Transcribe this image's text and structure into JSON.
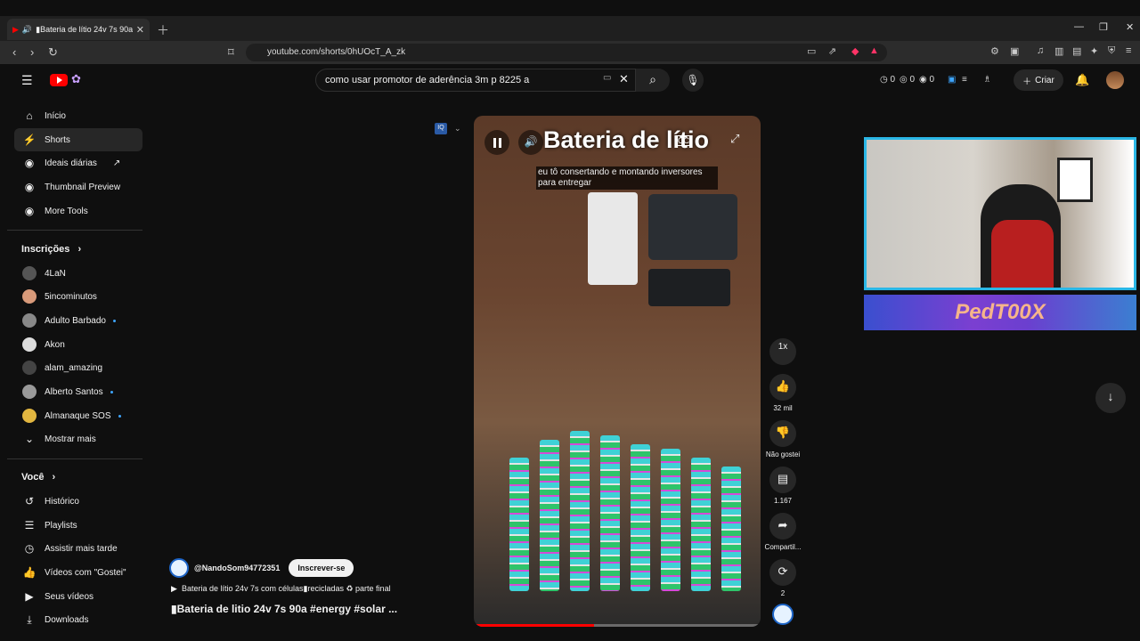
{
  "browser": {
    "tab_title": "▮Bateria de lítio 24v 7s 90a #",
    "url": "youtube.com/shorts/0hUOcT_A_zk"
  },
  "header": {
    "search_value": "como usar promotor de aderência 3m p 8225 a",
    "counts": [
      "0",
      "0",
      "0"
    ],
    "create_label": "Criar"
  },
  "sidebar": {
    "main": [
      {
        "label": "Início",
        "icon": "home-icon"
      },
      {
        "label": "Shorts",
        "icon": "shorts-icon"
      },
      {
        "label": "Ideais diárias",
        "icon": "tool-icon"
      },
      {
        "label": "Thumbnail Preview",
        "icon": "tool-icon"
      },
      {
        "label": "More Tools",
        "icon": "tool-icon"
      }
    ],
    "subscriptions_title": "Inscrições",
    "subscriptions": [
      {
        "label": "4LaN"
      },
      {
        "label": "5incominutos"
      },
      {
        "label": "Adulto Barbado"
      },
      {
        "label": "Akon"
      },
      {
        "label": "alam_amazing"
      },
      {
        "label": "Alberto Santos"
      },
      {
        "label": "Almanaque SOS"
      }
    ],
    "show_more": "Mostrar mais",
    "you_title": "Você",
    "you_items": [
      {
        "label": "Histórico",
        "icon": "history-icon"
      },
      {
        "label": "Playlists",
        "icon": "playlist-icon"
      },
      {
        "label": "Assistir mais tarde",
        "icon": "clock-icon"
      },
      {
        "label": "Vídeos com \"Gostei\"",
        "icon": "like-icon"
      },
      {
        "label": "Seus vídeos",
        "icon": "video-icon"
      },
      {
        "label": "Downloads",
        "icon": "download-icon"
      }
    ]
  },
  "video": {
    "overlay_title": "Bateria de lítio",
    "caption_line1": "eu tô consertando e montando inversores",
    "caption_line2": "para entregar",
    "cc_label": "CC",
    "progress": 0.42
  },
  "actions": {
    "speed": "1x",
    "likes": "32 mil",
    "dislike_label": "Não gostei",
    "comments": "1.167",
    "share_label": "Compartil...",
    "remix_count": "2"
  },
  "creator": {
    "handle": "@NandoSom94772351",
    "subscribe_label": "Inscrever-se",
    "description": "Bateria de lítio 24v 7s com células▮recicladas ♻ parte final",
    "title": "▮Bateria de litio 24v 7s 90a #energy #solar ..."
  },
  "overlay": {
    "banner_text": "PedT00X"
  }
}
